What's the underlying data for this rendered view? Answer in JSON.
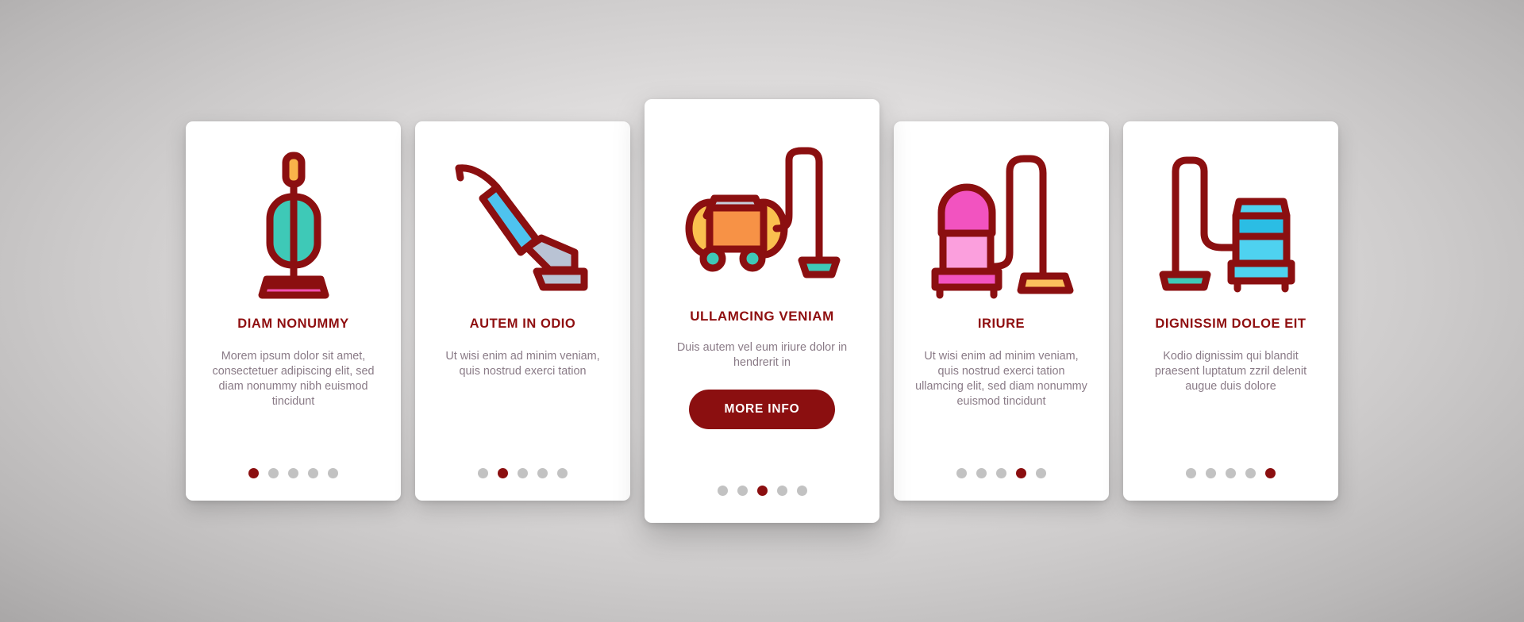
{
  "theme": {
    "brand_dark_red": "#8b0f10",
    "text_muted": "#8a7b87",
    "card_bg": "#ffffff",
    "dot_inactive": "#c2c2c2",
    "page_bg": "#d2d0d0"
  },
  "cards": [
    {
      "icon_name": "upright-vacuum-cleaner-icon",
      "title": "DIAM NONUMMY",
      "description": "Morem ipsum dolor sit amet, consectetuer adipiscing elit, sed diam nonummy nibh euismod tincidunt",
      "dots": {
        "count": 5,
        "active_index": 0
      },
      "featured": false,
      "cta_label": ""
    },
    {
      "icon_name": "carpet-sweeper-vacuum-icon",
      "title": "AUTEM IN ODIO",
      "description": "Ut wisi enim ad minim veniam, quis nostrud exerci tation",
      "dots": {
        "count": 5,
        "active_index": 1
      },
      "featured": false,
      "cta_label": ""
    },
    {
      "icon_name": "canister-vacuum-cleaner-icon",
      "title": "ULLAMCING VENIAM",
      "description": "Duis autem vel eum iriure dolor in hendrerit in",
      "dots": {
        "count": 5,
        "active_index": 2
      },
      "featured": true,
      "cta_label": "MORE INFO"
    },
    {
      "icon_name": "drum-vacuum-cleaner-icon",
      "title": "IRIURE",
      "description": "Ut wisi enim ad minim veniam, quis nostrud exerci tation ullamcing elit, sed diam nonummy euismod tincidunt",
      "dots": {
        "count": 5,
        "active_index": 3
      },
      "featured": false,
      "cta_label": ""
    },
    {
      "icon_name": "tank-vacuum-cleaner-icon",
      "title": "DIGNISSIM DOLOE EIT",
      "description": "Kodio dignissim qui blandit praesent luptatum zzril delenit augue duis dolore",
      "dots": {
        "count": 5,
        "active_index": 4
      },
      "featured": false,
      "cta_label": ""
    }
  ]
}
